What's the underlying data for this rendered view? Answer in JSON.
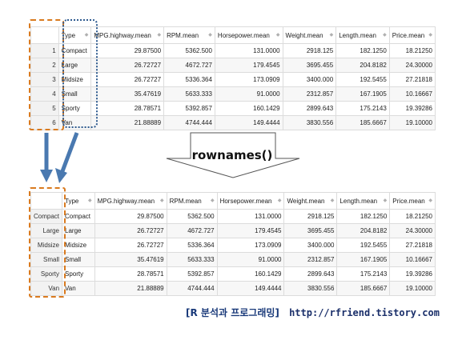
{
  "function_label": "rownames()",
  "footer": {
    "blog": "[R 분석과 프로그래밍]",
    "url": "http://rfriend.tistory.com"
  },
  "columns": [
    "Type",
    "MPG.highway.mean",
    "RPM.mean",
    "Horsepower.mean",
    "Weight.mean",
    "Length.mean",
    "Price.mean"
  ],
  "before": {
    "row_index": [
      "1",
      "2",
      "3",
      "4",
      "5",
      "6"
    ],
    "rows": [
      [
        "Compact",
        "29.87500",
        "5362.500",
        "131.0000",
        "2918.125",
        "182.1250",
        "18.21250"
      ],
      [
        "Large",
        "26.72727",
        "4672.727",
        "179.4545",
        "3695.455",
        "204.8182",
        "24.30000"
      ],
      [
        "Midsize",
        "26.72727",
        "5336.364",
        "173.0909",
        "3400.000",
        "192.5455",
        "27.21818"
      ],
      [
        "Small",
        "35.47619",
        "5633.333",
        "91.0000",
        "2312.857",
        "167.1905",
        "10.16667"
      ],
      [
        "Sporty",
        "28.78571",
        "5392.857",
        "160.1429",
        "2899.643",
        "175.2143",
        "19.39286"
      ],
      [
        "Van",
        "21.88889",
        "4744.444",
        "149.4444",
        "3830.556",
        "185.6667",
        "19.10000"
      ]
    ]
  },
  "after": {
    "row_index": [
      "Compact",
      "Large",
      "Midsize",
      "Small",
      "Sporty",
      "Van"
    ],
    "rows": [
      [
        "Compact",
        "29.87500",
        "5362.500",
        "131.0000",
        "2918.125",
        "182.1250",
        "18.21250"
      ],
      [
        "Large",
        "26.72727",
        "4672.727",
        "179.4545",
        "3695.455",
        "204.8182",
        "24.30000"
      ],
      [
        "Midsize",
        "26.72727",
        "5336.364",
        "173.0909",
        "3400.000",
        "192.5455",
        "27.21818"
      ],
      [
        "Small",
        "35.47619",
        "5633.333",
        "91.0000",
        "2312.857",
        "167.1905",
        "10.16667"
      ],
      [
        "Sporty",
        "28.78571",
        "5392.857",
        "160.1429",
        "2899.643",
        "175.2143",
        "19.39286"
      ],
      [
        "Van",
        "21.88889",
        "4744.444",
        "149.4444",
        "3830.556",
        "185.6667",
        "19.10000"
      ]
    ]
  },
  "colors": {
    "highlight_orange": "#d97a1f",
    "highlight_blue": "#2f5b8f",
    "arrow_blue": "#4a79b0"
  }
}
